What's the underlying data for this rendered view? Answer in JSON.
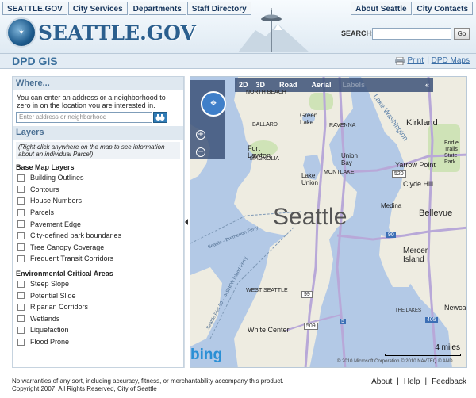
{
  "header": {
    "nav_left": [
      "SEATTLE.GOV",
      "City Services",
      "Departments",
      "Staff Directory"
    ],
    "nav_right": [
      "About Seattle",
      "City Contacts"
    ],
    "logo_text": "SEATTLE.GOV",
    "search_label": "SEARCH:",
    "search_value": "",
    "go_label": "Go"
  },
  "titlebar": {
    "title": "DPD GIS",
    "print_label": "Print",
    "separator": "|",
    "maps_label": "DPD Maps"
  },
  "where": {
    "heading": "Where...",
    "instructions": "You can enter an address or a neighborhood to zero in on the location you are interested in.",
    "address_placeholder": "Enter address or neighborhood"
  },
  "layers": {
    "heading": "Layers",
    "note": "(Right-click anywhere on the map to see information about an individual Parcel)",
    "groups": [
      {
        "title": "Base Map Layers",
        "items": [
          "Building Outlines",
          "Contours",
          "House Numbers",
          "Parcels",
          "Pavement Edge",
          "City-defined park boundaries",
          "Tree Canopy Coverage",
          "Frequent Transit Corridors"
        ]
      },
      {
        "title": "Environmental Critical Areas",
        "items": [
          "Steep Slope",
          "Potential Slide",
          "Riparian Corridors",
          "Wetlands",
          "Liquefaction",
          "Flood Prone"
        ]
      }
    ]
  },
  "map": {
    "toolbar": [
      "2D",
      "3D",
      "Road",
      "Aerial",
      "Labels",
      "«"
    ],
    "city_label": "Seattle",
    "places": [
      "NORTH BEACH",
      "Kirkland",
      "Green Lake",
      "BALLARD",
      "RAVENNA",
      "Fort Lawton",
      "MAGNOLIA",
      "Union Bay",
      "MONTLAKE",
      "Lake Union",
      "Yarrow Point",
      "Clyde Hill",
      "Bridle Trails State Park",
      "Medina",
      "Bellevue",
      "Mercer Island",
      "WEST SEATTLE",
      "White Center",
      "THE LAKES",
      "Newcas",
      "Lake Washington"
    ],
    "road_shields": [
      "520",
      "90",
      "99",
      "509",
      "5",
      "405"
    ],
    "water_labels": [
      "Seattle - Bremerton Ferry",
      "Seattle Pier 50 - VASHON Island Ferry"
    ],
    "scale_label": "4 miles",
    "copyright": "© 2010 Microsoft Corporation  © 2010 NAVTEQ  © AND",
    "bing": "bing"
  },
  "footer": {
    "disclaimer": "No warranties of any sort, including accuracy, fitness, or merchantability accompany this product.",
    "copyright": "Copyright 2007, All Rights Reserved, City of Seattle",
    "links": [
      "About",
      "Help",
      "Feedback"
    ]
  },
  "colors": {
    "water": "#b3c9e6",
    "land": "#eeece1",
    "highway": "#b8a8d8",
    "accent": "#3a6f9c"
  }
}
